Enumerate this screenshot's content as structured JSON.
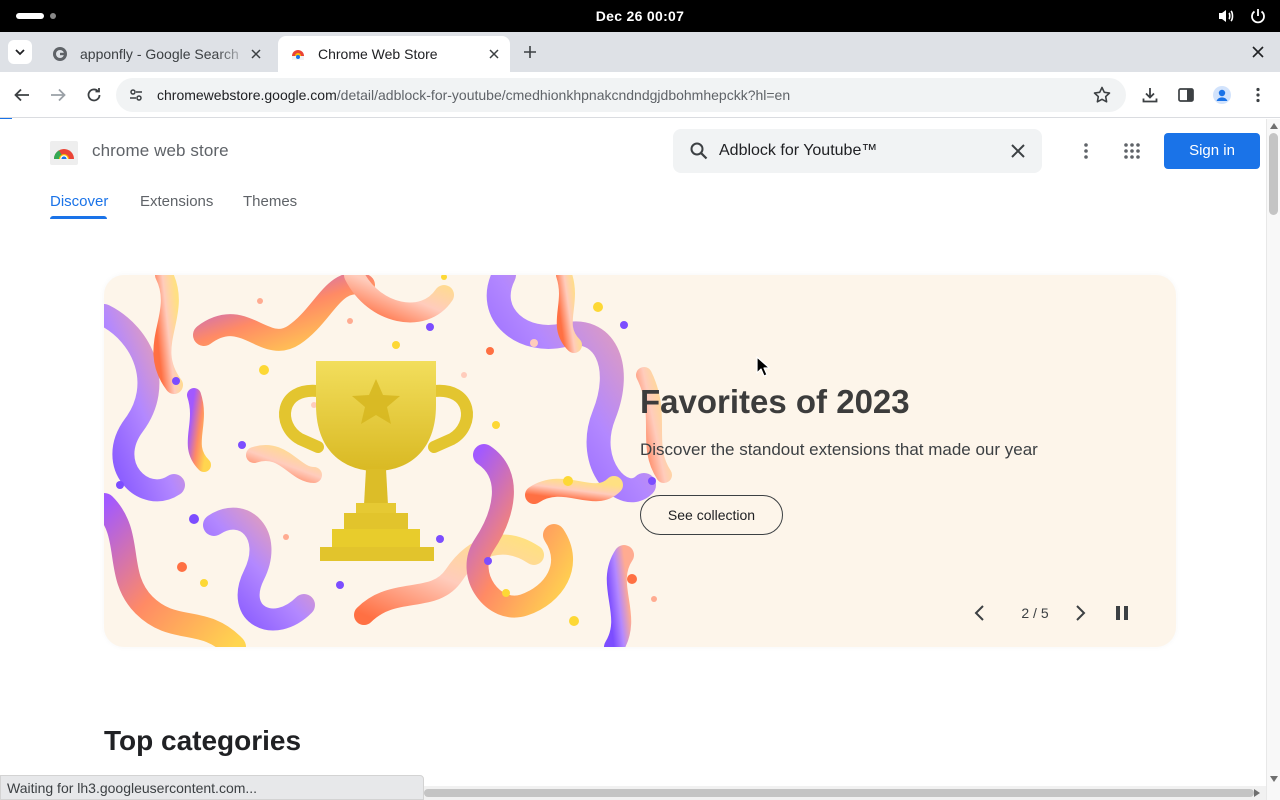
{
  "system": {
    "clock": "Dec 26  00:07"
  },
  "tabs": [
    {
      "title": "apponfly - Google Search",
      "favicon": "google-g-icon",
      "active": false
    },
    {
      "title": "Chrome Web Store",
      "favicon": "chrome-web-store-icon",
      "active": true
    }
  ],
  "toolbar": {
    "url_host": "chromewebstore.google.com",
    "url_path": "/detail/adblock-for-youtube/cmedhionkhpnakcndndgjdbohmhepckk?hl=en"
  },
  "store": {
    "brand": "chrome web store",
    "search_value": "Adblock for Youtube™",
    "sign_in": "Sign in",
    "nav": [
      "Discover",
      "Extensions",
      "Themes"
    ],
    "active_nav": "Discover"
  },
  "hero": {
    "title": "Favorites of 2023",
    "subtitle": "Discover the standout extensions that made our year",
    "button": "See collection",
    "counter": "2 / 5"
  },
  "section": {
    "title": "Top categories"
  },
  "status_bar": "Waiting for lh3.googleusercontent.com...",
  "colors": {
    "accent": "#1a73e8",
    "hero_bg": "#fdf5ea",
    "trophy": "#e8cc2c"
  }
}
